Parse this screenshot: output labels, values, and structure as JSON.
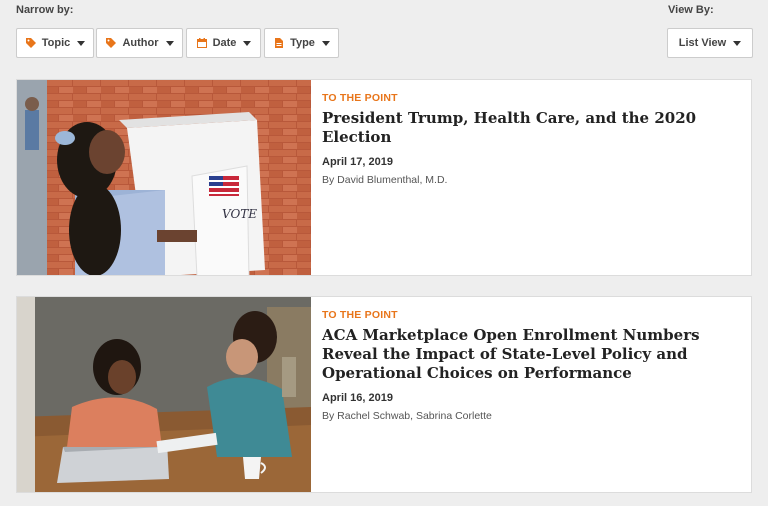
{
  "filters": {
    "narrow_label": "Narrow by:",
    "topic": "Topic",
    "author": "Author",
    "date": "Date",
    "type": "Type"
  },
  "view": {
    "label": "View By:",
    "selected": "List View"
  },
  "colors": {
    "accent": "#e8751a",
    "title": "#222222"
  },
  "articles": [
    {
      "kicker": "TO THE POINT",
      "title": "President Trump, Health Care, and the 2020 Election",
      "date": "April 17, 2019",
      "byline": "By David Blumenthal, M.D.",
      "image": "voting-booth-photo"
    },
    {
      "kicker": "TO THE POINT",
      "title": "ACA Marketplace Open Enrollment Numbers Reveal the Impact of State-Level Policy and Operational Choices on Performance",
      "date": "April 16, 2019",
      "byline": "By Rachel Schwab, Sabrina Corlette",
      "image": "laptop-meeting-photo"
    }
  ]
}
